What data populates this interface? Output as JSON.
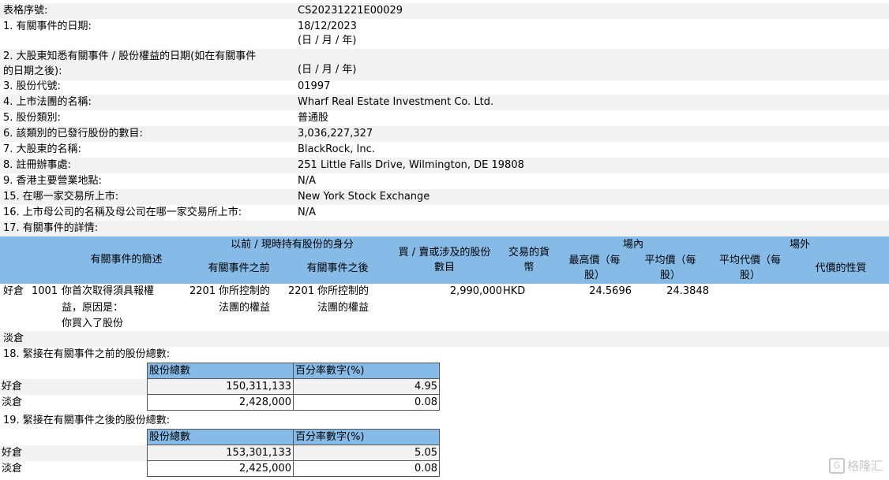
{
  "form_no": {
    "label": "表格序號:",
    "value": "CS20231221E00029"
  },
  "items": [
    {
      "label": "1. 有關事件的日期:",
      "value": "18/12/2023",
      "sub": "(日 / 月 / 年)"
    },
    {
      "label": "2. 大股東知悉有關事件 / 股份權益的日期(如在有關事件",
      "label2": "的日期之後):",
      "value": "(日 / 月 / 年)"
    },
    {
      "label": "3. 股份代號:",
      "value": "01997"
    },
    {
      "label": "4. 上市法團的名稱:",
      "value": "Wharf Real Estate Investment Co. Ltd."
    },
    {
      "label": "5. 股份類別:",
      "value": "普通股"
    },
    {
      "label": "6. 該類別的已發行股份的數目:",
      "value": "3,036,227,327"
    },
    {
      "label": "7. 大股東的名稱:",
      "value": "BlackRock, Inc."
    },
    {
      "label": "8. 註冊辦事處:",
      "value": "251 Little Falls Drive, Wilmington, DE 19808"
    },
    {
      "label": "9. 香港主要營業地點:",
      "value": "N/A"
    },
    {
      "label": "15. 在哪一家交易所上市:",
      "value": "New York Stock Exchange"
    },
    {
      "label": "16. 上市母公司的名稱及母公司在哪一家交易所上市:",
      "value": "N/A"
    },
    {
      "label": "17. 有關事件的詳情:"
    }
  ],
  "details": {
    "headers": {
      "event_desc": "有關事件的簡述",
      "capacity": "以前 / 現時持有股份的身分",
      "before": "有關事件之前",
      "after": "有關事件之後",
      "shares_l1": "買 / 賣或涉及的股份",
      "shares_l2": "數目",
      "currency_l1": "交易的貨",
      "currency_l2": "幣",
      "onex": "場內",
      "high_l1": "最高價（每",
      "high_l2": "股）",
      "avg_l1": "平均價（每",
      "avg_l2": "股）",
      "offex": "場外",
      "avg_cons_l1": "平均代價（每",
      "avg_cons_l2": "股）",
      "consideration": "代價的性質"
    },
    "row": {
      "position": "好倉",
      "code": "1001",
      "desc_l1": "你首次取得須具報權",
      "desc_l2": "益，原因是：",
      "desc_l3": "你買入了股份",
      "before_code": "2201",
      "before_l1": "你所控制的",
      "before_l2": "法團的權益",
      "after_code": "2201",
      "after_l1": "你所控制的",
      "after_l2": "法團的權益",
      "shares": "2,990,000",
      "currency": "HKD",
      "high": "24.5696",
      "avg": "24.3848"
    },
    "short_label": "淡倉"
  },
  "sec18": {
    "title": "18. 緊接在有關事件之前的股份總數:",
    "col1": "股份總數",
    "col2": "百分率數字(%)",
    "rows": [
      {
        "label": "好倉",
        "total": "150,311,133",
        "pct": "4.95"
      },
      {
        "label": "淡倉",
        "total": "2,428,000",
        "pct": "0.08"
      }
    ]
  },
  "sec19": {
    "title": "19. 緊接在有關事件之後的股份總數:",
    "col1": "股份總數",
    "col2": "百分率數字(%)",
    "rows": [
      {
        "label": "好倉",
        "total": "153,301,133",
        "pct": "5.05"
      },
      {
        "label": "淡倉",
        "total": "2,425,000",
        "pct": "0.08"
      }
    ]
  },
  "watermark": "格隆汇"
}
